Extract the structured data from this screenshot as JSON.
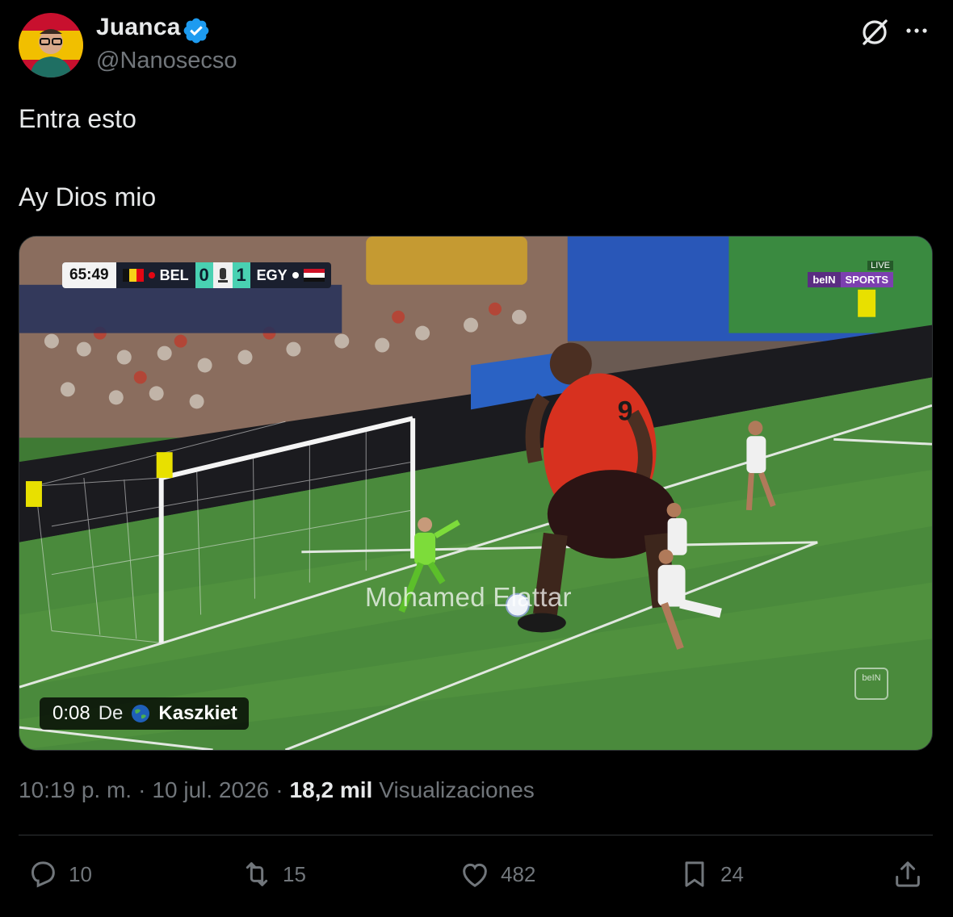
{
  "author": {
    "name": "Juanca",
    "handle": "@Nanosecso",
    "verified": true
  },
  "header": {
    "grok_icon": "grok-icon",
    "more_icon": "more-icon"
  },
  "tweet": {
    "lines": [
      "Entra esto",
      "Ay Dios mio"
    ]
  },
  "video": {
    "scorebug": {
      "clock": "65:49",
      "home": "BEL",
      "home_score": "0",
      "away_score": "1",
      "away": "EGY"
    },
    "broadcaster": {
      "live": "LIVE",
      "brand": "beIN",
      "channel": "SPORTS"
    },
    "overlay_name": "Mohamed Elattar",
    "duration": "0:08",
    "from_label": "De",
    "source_user": "Kaszkiet",
    "shirt_number": "9"
  },
  "meta": {
    "time": "10:19 p. m.",
    "separator": "·",
    "date": "10 jul. 2026",
    "views_count": "18,2 mil",
    "views_label": "Visualizaciones"
  },
  "actions": {
    "replies": "10",
    "reposts": "15",
    "likes": "482",
    "bookmarks": "24"
  },
  "colors": {
    "background": "#000000",
    "text_primary": "#e7e9ea",
    "text_secondary": "#71767b",
    "verified_blue": "#1d9bf0",
    "divider": "#2f3336"
  }
}
